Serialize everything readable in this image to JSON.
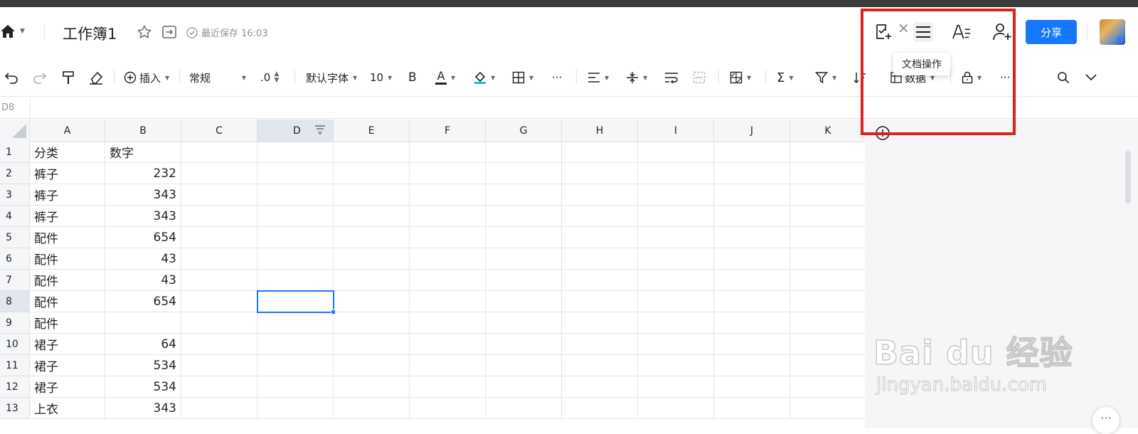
{
  "header": {
    "title": "工作簿1",
    "saved_status": "最近保存 16:03",
    "tooltip": "文档操作",
    "share_label": "分享"
  },
  "toolbar": {
    "insert_label": "插入",
    "format_value": "常规",
    "decimal_label": ".0",
    "font_family": "默认字体",
    "font_size": "10",
    "bold_label": "B",
    "font_color_label": "A",
    "more": "···",
    "data_label": "数据"
  },
  "formula_bar": {
    "cell_ref": "D8"
  },
  "grid": {
    "columns": [
      "A",
      "B",
      "C",
      "D",
      "E",
      "F",
      "G",
      "H",
      "I",
      "J",
      "K"
    ],
    "selected_column": "D",
    "selected_row": 8,
    "rows": [
      {
        "n": "1",
        "a": "分类",
        "b": "数字"
      },
      {
        "n": "2",
        "a": "裤子",
        "b": "232"
      },
      {
        "n": "3",
        "a": "裤子",
        "b": "343"
      },
      {
        "n": "4",
        "a": "裤子",
        "b": "343"
      },
      {
        "n": "5",
        "a": "配件",
        "b": "654"
      },
      {
        "n": "6",
        "a": "配件",
        "b": "43"
      },
      {
        "n": "7",
        "a": "配件",
        "b": "43"
      },
      {
        "n": "8",
        "a": "配件",
        "b": "654"
      },
      {
        "n": "9",
        "a": "配件",
        "b": ""
      },
      {
        "n": "10",
        "a": "裙子",
        "b": "64"
      },
      {
        "n": "11",
        "a": "裙子",
        "b": "534"
      },
      {
        "n": "12",
        "a": "裙子",
        "b": "534"
      },
      {
        "n": "13",
        "a": "上衣",
        "b": "343"
      }
    ]
  },
  "watermark": {
    "main": "Bai du 经验",
    "sub": "jingyan.baidu.com"
  },
  "colors": {
    "accent": "#1677ff",
    "highlight_box": "#e02020"
  }
}
